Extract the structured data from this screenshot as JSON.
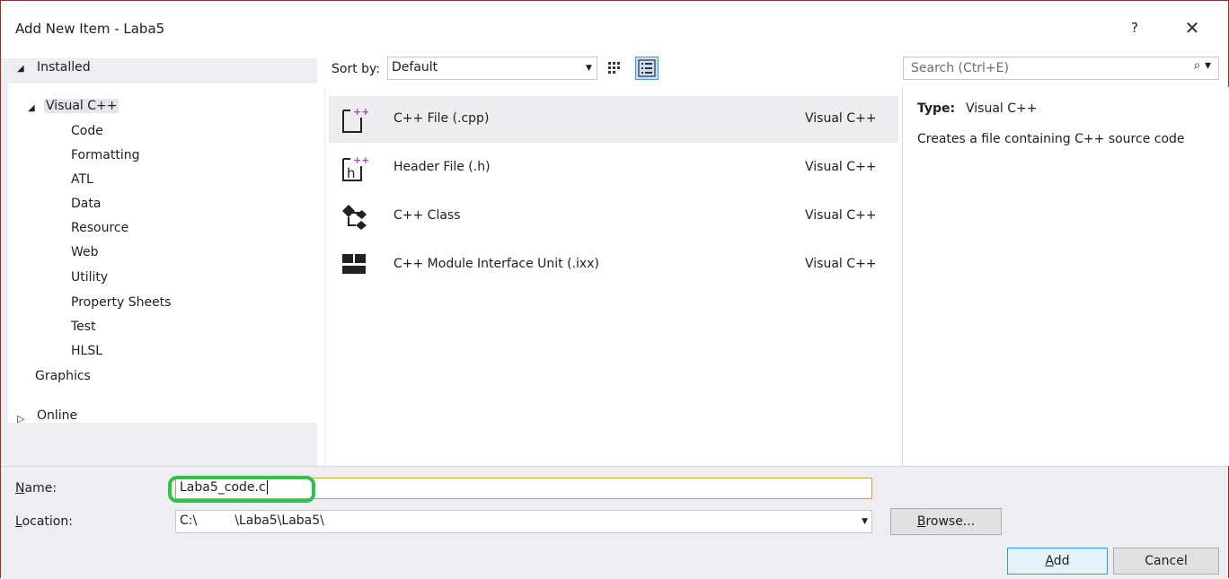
{
  "window": {
    "title": "Add New Item - Laba5",
    "help_label": "?",
    "close_label": "✕"
  },
  "tree": {
    "installed_label": "Installed",
    "root_label": "Visual C++",
    "children": [
      "Code",
      "Formatting",
      "ATL",
      "Data",
      "Resource",
      "Web",
      "Utility",
      "Property Sheets",
      "Test",
      "HLSL"
    ],
    "graphics_label": "Graphics",
    "online_label": "Online"
  },
  "toolbar": {
    "sort_by_label": "Sort by:",
    "sort_value": "Default",
    "search_placeholder": "Search (Ctrl+E)"
  },
  "items": [
    {
      "name": "C++ File (.cpp)",
      "lang": "Visual C++",
      "icon": "cpp-file-icon",
      "selected": true
    },
    {
      "name": "Header File (.h)",
      "lang": "Visual C++",
      "icon": "header-file-icon",
      "selected": false
    },
    {
      "name": "C++ Class",
      "lang": "Visual C++",
      "icon": "cpp-class-icon",
      "selected": false
    },
    {
      "name": "C++ Module Interface Unit (.ixx)",
      "lang": "Visual C++",
      "icon": "module-unit-icon",
      "selected": false
    }
  ],
  "details": {
    "type_label": "Type:",
    "type_value": "Visual C++",
    "description": "Creates a file containing C++ source code"
  },
  "form": {
    "name_label_first": "N",
    "name_label_rest": "ame:",
    "name_value": "Laba5_code.c",
    "location_label_first": "L",
    "location_label_rest": "ocation:",
    "location_prefix": "C:\\",
    "location_suffix": "\\Laba5\\Laba5\\",
    "browse_first": "B",
    "browse_rest": "rowse...",
    "add_first": "A",
    "add_rest": "dd",
    "cancel_label": "Cancel"
  },
  "colors": {
    "highlight_ring": "#2ec34a",
    "panel_bg": "#eeeef2",
    "selected_bg": "#ededf0"
  }
}
